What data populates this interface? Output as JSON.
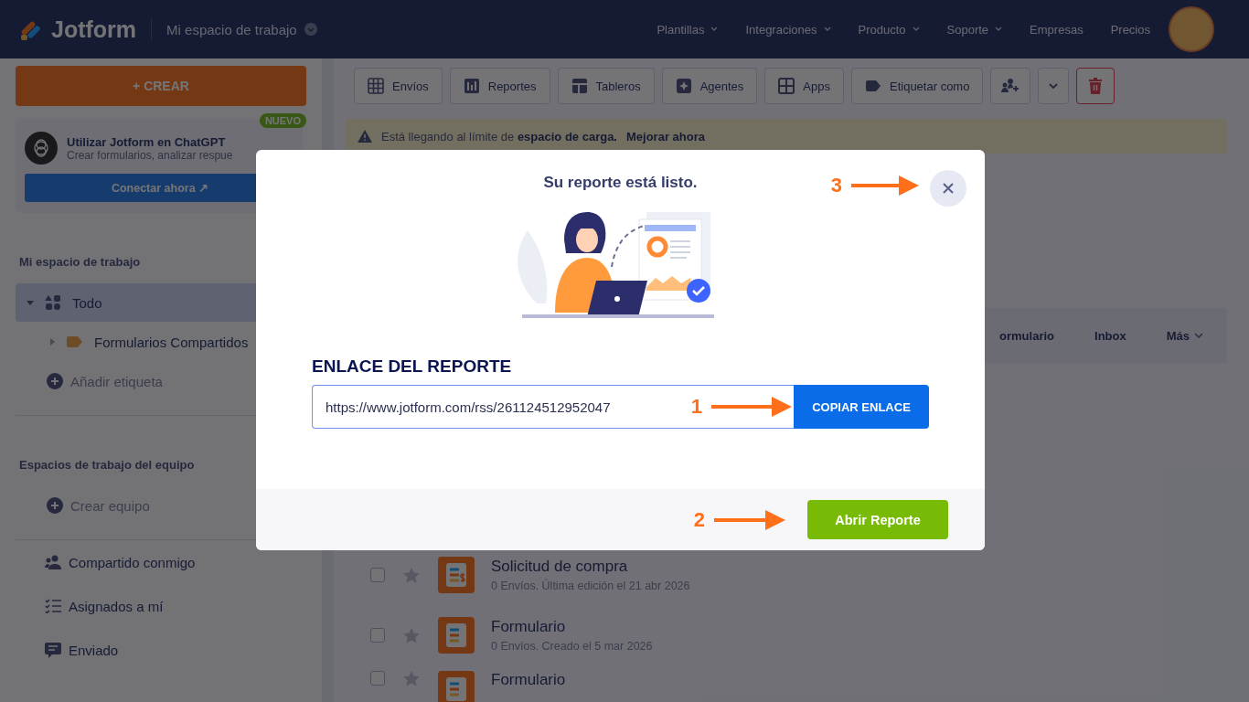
{
  "nav": {
    "logo": "Jotform",
    "workspace": "Mi espacio de trabajo",
    "links": [
      {
        "label": "Plantillas",
        "dropdown": true
      },
      {
        "label": "Integraciones",
        "dropdown": true
      },
      {
        "label": "Producto",
        "dropdown": true
      },
      {
        "label": "Soporte",
        "dropdown": true
      },
      {
        "label": "Empresas",
        "dropdown": false
      },
      {
        "label": "Precios",
        "dropdown": false
      }
    ]
  },
  "sidebar": {
    "create_button": "+ CREAR",
    "promo": {
      "badge": "NUEVO",
      "title": "Utilizar Jotform en ChatGPT",
      "subtitle": "Crear formularios, analizar respue",
      "button": "Conectar ahora ↗"
    },
    "workspace_heading": "Mi espacio de trabajo",
    "tree": [
      {
        "label": "Todo",
        "selected": true,
        "expanded": true,
        "children": [
          {
            "label": "Formularios Compartidos",
            "selected": false,
            "expanded": false
          }
        ]
      }
    ],
    "add_label": "Añadir etiqueta",
    "team_heading": "Espacios de trabajo del equipo",
    "create_team": "Crear equipo",
    "items": [
      {
        "label": "Compartido conmigo",
        "kind": "people"
      },
      {
        "label": "Asignados a mí",
        "kind": "checklist"
      },
      {
        "label": "Enviado",
        "kind": "message"
      }
    ]
  },
  "toolbar": {
    "buttons": [
      {
        "label": "Envíos",
        "kind": "grid"
      },
      {
        "label": "Reportes",
        "kind": "bars"
      },
      {
        "label": "Tableros",
        "kind": "board"
      },
      {
        "label": "Agentes",
        "kind": "agent"
      },
      {
        "label": "Apps",
        "kind": "apps"
      },
      {
        "label": "Etiquetar como",
        "kind": "tag"
      }
    ],
    "icon_buttons": [
      {
        "kind": "people"
      },
      {
        "kind": "chevron"
      },
      {
        "kind": "trash"
      }
    ]
  },
  "banner": {
    "text": "Está llegando al límite de",
    "bold": "espacio de carga.",
    "link": "Mejorar ahora"
  },
  "filters": [
    {
      "label": "ormulario",
      "dropdown": false
    },
    {
      "label": "Inbox",
      "dropdown": false
    },
    {
      "label": "Más",
      "dropdown": true
    }
  ],
  "forms": [
    {
      "title": "Solicitud de compra",
      "meta": "0 Envíos. Última edición el 21 abr 2026",
      "kind": "payment",
      "checked": false
    },
    {
      "title": "Formulario",
      "meta": "0 Envíos. Creado el 5 mar 2026",
      "kind": "form",
      "checked": false
    },
    {
      "title": "Formulario",
      "kind": "form",
      "checked": false
    }
  ],
  "modal": {
    "title": "Su reporte está listo.",
    "link_heading": "ENLACE DEL REPORTE",
    "url": "https://www.jotform.com/rss/261124512952047",
    "copy_button": "COPIAR ENLACE",
    "open_button": "Abrir Reporte",
    "copy_step": "1",
    "open_step": "2",
    "close_step": "3"
  }
}
